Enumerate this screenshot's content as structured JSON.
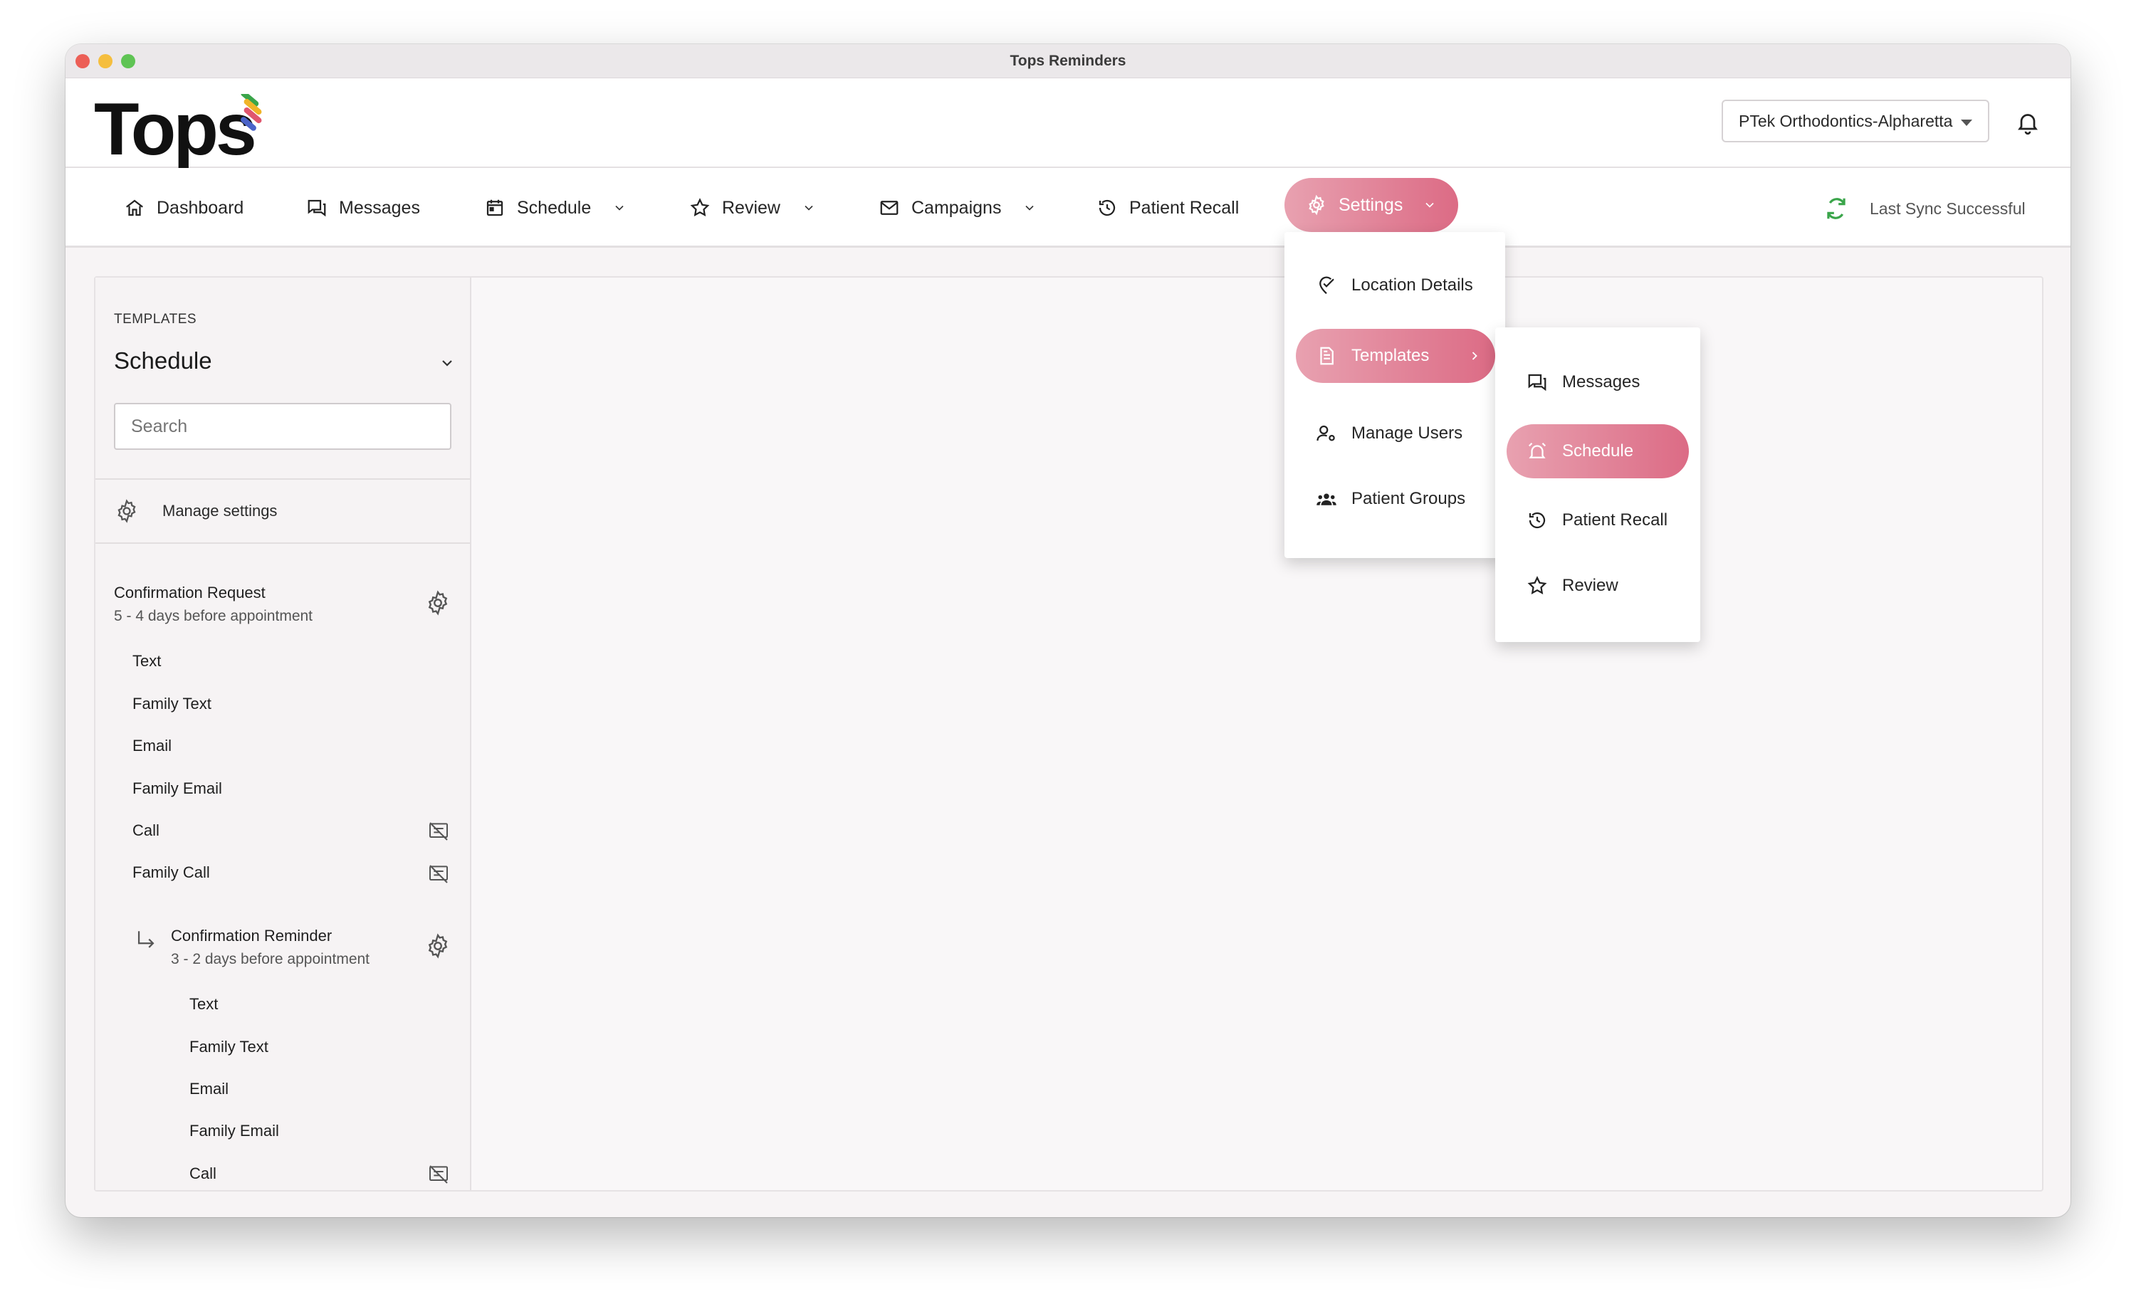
{
  "window": {
    "title": "Tops Reminders"
  },
  "brand": {
    "logo_text": "Tops"
  },
  "header": {
    "location": "PTek Orthodontics-Alpharetta"
  },
  "nav": {
    "dashboard": "Dashboard",
    "messages": "Messages",
    "schedule": "Schedule",
    "review": "Review",
    "campaigns": "Campaigns",
    "patient_recall": "Patient Recall",
    "settings": "Settings",
    "sync_status": "Last Sync Successful"
  },
  "sidebar": {
    "section_label": "TEMPLATES",
    "selected_type": "Schedule",
    "search_placeholder": "Search",
    "manage_settings": "Manage settings",
    "templates": [
      {
        "title": "Confirmation Request",
        "subtitle": "5 - 4 days before appointment",
        "channels": [
          "Text",
          "Family Text",
          "Email",
          "Family Email",
          "Call",
          "Family Call"
        ]
      },
      {
        "title": "Confirmation Reminder",
        "subtitle": "3 - 2 days before appointment",
        "channels": [
          "Text",
          "Family Text",
          "Email",
          "Family Email",
          "Call"
        ]
      }
    ]
  },
  "settings_menu": {
    "items": [
      "Location Details",
      "Templates",
      "Manage Users",
      "Patient Groups"
    ]
  },
  "templates_submenu": {
    "items": [
      "Messages",
      "Schedule",
      "Patient Recall",
      "Review"
    ]
  },
  "colors": {
    "accent_start": "#e8a1b0",
    "accent_end": "#dc6b85",
    "sync_green": "#3aa54a"
  }
}
